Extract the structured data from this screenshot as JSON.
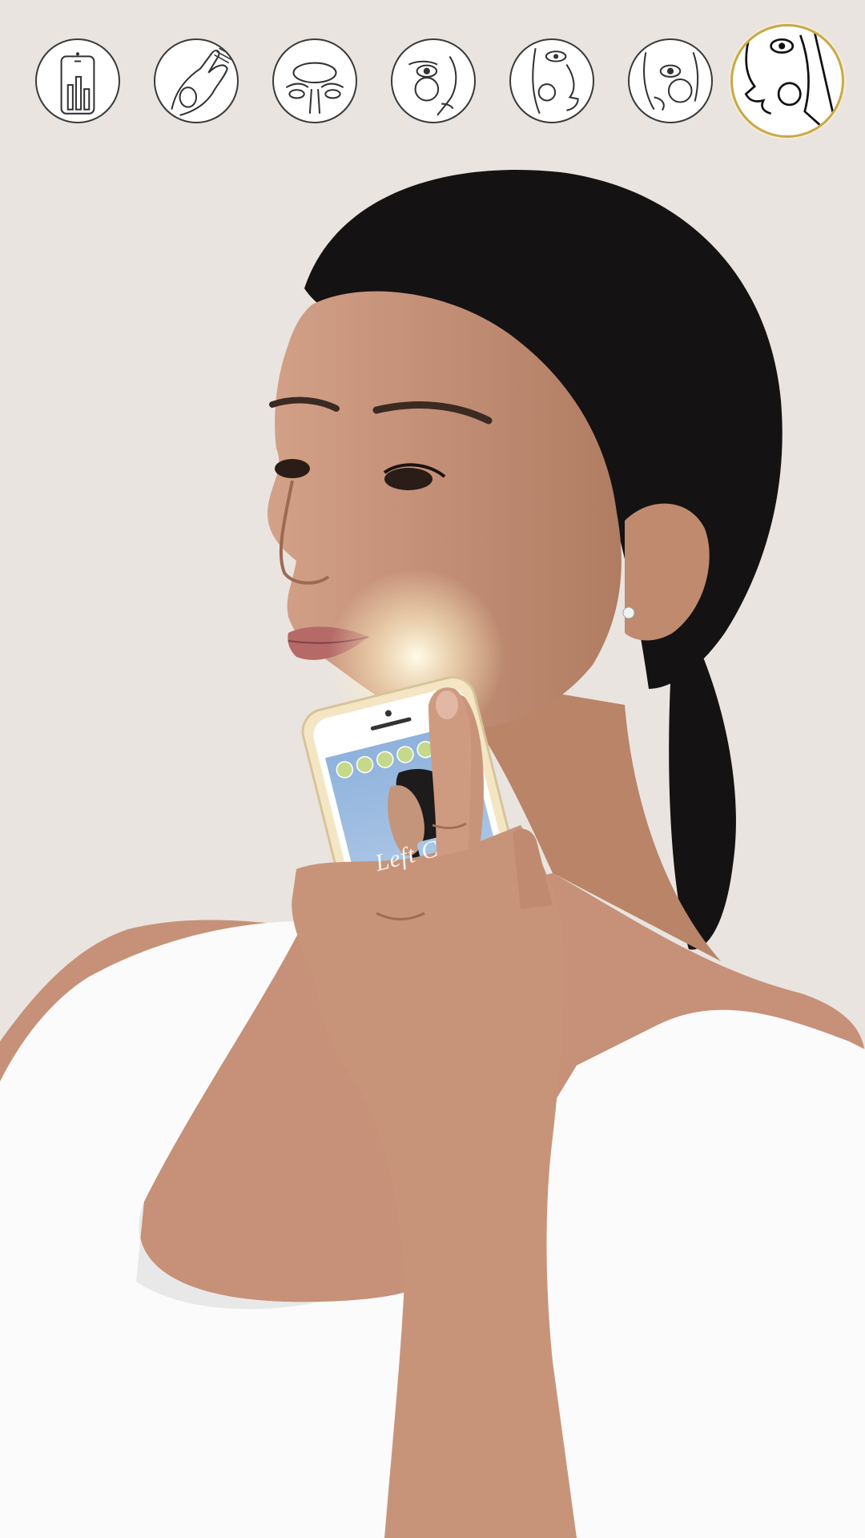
{
  "steps": [
    {
      "name": "phone-chart-step",
      "icon": "phone-chart-icon",
      "active": false
    },
    {
      "name": "hand-step",
      "icon": "hand-icon",
      "active": false
    },
    {
      "name": "forehead-step",
      "icon": "forehead-icon",
      "active": false
    },
    {
      "name": "right-cheek-step",
      "icon": "right-cheek-icon",
      "active": false
    },
    {
      "name": "chin-step",
      "icon": "chin-icon",
      "active": false
    },
    {
      "name": "left-cheek-step",
      "icon": "left-cheek-icon",
      "active": false
    },
    {
      "name": "jaw-step",
      "icon": "jaw-icon",
      "active": true
    }
  ],
  "phone_screen": {
    "label": "Left C",
    "checkmarks": 5
  },
  "colors": {
    "background": "#e9e4df",
    "active_ring": "#c8a84a",
    "hair": "#141212",
    "skin": "#c08d72",
    "top": "#fbfbfb",
    "check": "#c5d98a"
  }
}
